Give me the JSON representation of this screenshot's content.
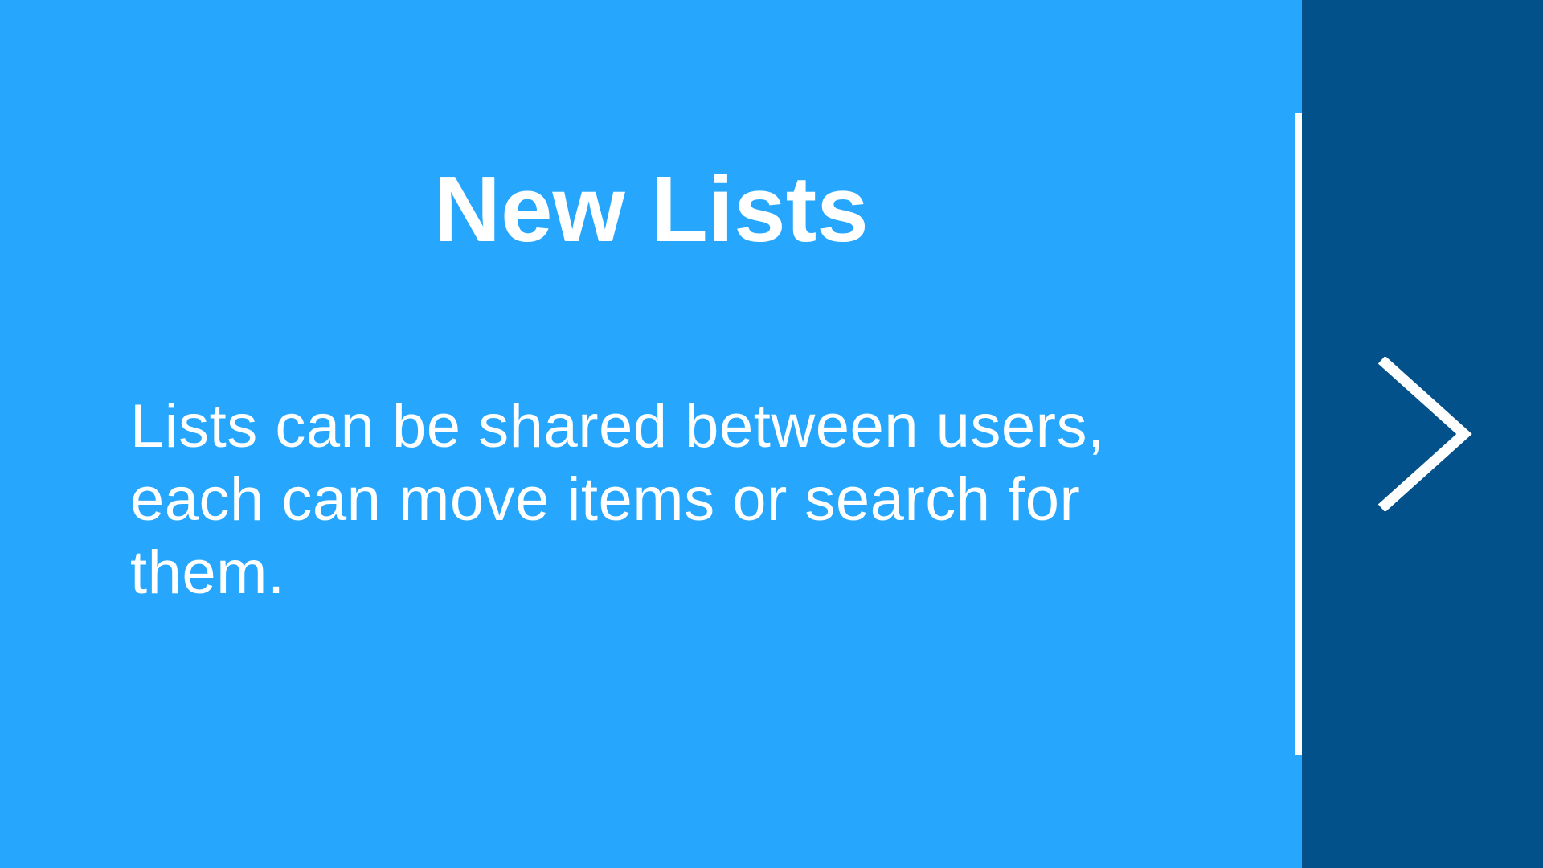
{
  "slide": {
    "title": "New Lists",
    "body": "Lists can be shared between users, each can move items or search for them."
  },
  "navigation": {
    "next_icon": "chevron-right-icon"
  },
  "colors": {
    "main_background": "#26a7fd",
    "side_panel_background": "#02518a",
    "text": "#ffffff",
    "divider": "#ffffff"
  }
}
